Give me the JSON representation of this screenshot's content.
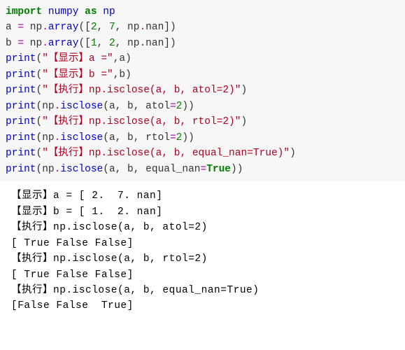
{
  "code": {
    "l1_import": "import",
    "l1_numpy": "numpy",
    "l1_as": "as",
    "l1_np": "np",
    "l2_a": "a ",
    "l2_eq": "=",
    "l2_np": " np",
    "l2_dot": ".",
    "l2_array": "array",
    "l2_open": "([",
    "l2_n1": "2",
    "l2_c1": ", ",
    "l2_n2": "7",
    "l2_c2": ", np",
    "l2_dot2": ".",
    "l2_nan": "nan])",
    "l3_b": "b ",
    "l3_eq": "=",
    "l3_np": " np",
    "l3_dot": ".",
    "l3_array": "array",
    "l3_open": "([",
    "l3_n1": "1",
    "l3_c1": ", ",
    "l3_n2": "2",
    "l3_c2": ", np",
    "l3_dot2": ".",
    "l3_nan": "nan])",
    "l4_print": "print",
    "l4_open": "(",
    "l4_str": "\"【显示】a =\"",
    "l4_rest": ",a)",
    "l5_print": "print",
    "l5_open": "(",
    "l5_str": "\"【显示】b =\"",
    "l5_rest": ",b)",
    "l6_print": "print",
    "l6_open": "(",
    "l6_str": "\"【执行】np.isclose(a, b, atol=2)\"",
    "l6_close": ")",
    "l7_print": "print",
    "l7_open": "(np",
    "l7_dot": ".",
    "l7_fn": "isclose",
    "l7_args": "(a, b, atol",
    "l7_eq": "=",
    "l7_num": "2",
    "l7_close": "))",
    "l8_print": "print",
    "l8_open": "(",
    "l8_str": "\"【执行】np.isclose(a, b, rtol=2)\"",
    "l8_close": ")",
    "l9_print": "print",
    "l9_open": "(np",
    "l9_dot": ".",
    "l9_fn": "isclose",
    "l9_args": "(a, b, rtol",
    "l9_eq": "=",
    "l9_num": "2",
    "l9_close": "))",
    "l10_print": "print",
    "l10_open": "(",
    "l10_str": "\"【执行】np.isclose(a, b, equal_nan=True)\"",
    "l10_close": ")",
    "l11_print": "print",
    "l11_open": "(np",
    "l11_dot": ".",
    "l11_fn": "isclose",
    "l11_args": "(a, b, equal_nan",
    "l11_eq": "=",
    "l11_true": "True",
    "l11_close": "))"
  },
  "output": {
    "o1": "【显示】a = [ 2.  7. nan]",
    "o2": "【显示】b = [ 1.  2. nan]",
    "o3": "【执行】np.isclose(a, b, atol=2)",
    "o4": "[ True False False]",
    "o5": "【执行】np.isclose(a, b, rtol=2)",
    "o6": "[ True False False]",
    "o7": "【执行】np.isclose(a, b, equal_nan=True)",
    "o8": "[False False  True]"
  }
}
